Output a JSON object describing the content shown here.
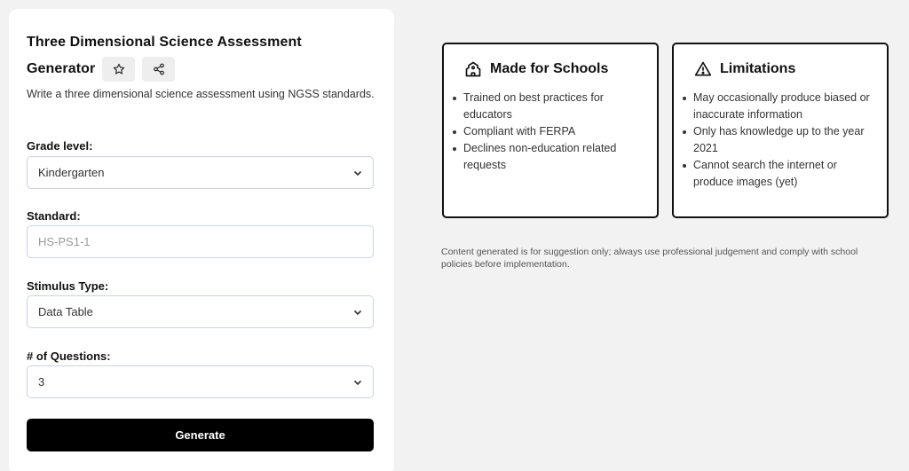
{
  "form": {
    "title_line1": "Three Dimensional Science Assessment",
    "title_line2": "Generator",
    "description": "Write a three dimensional science assessment using NGSS standards.",
    "grade_level": {
      "label": "Grade level:",
      "value": "Kindergarten"
    },
    "standard": {
      "label": "Standard:",
      "placeholder": "HS-PS1-1"
    },
    "stimulus_type": {
      "label": "Stimulus Type:",
      "value": "Data Table"
    },
    "num_questions": {
      "label": "# of Questions:",
      "value": "3"
    },
    "generate_label": "Generate"
  },
  "made_for_schools": {
    "title": "Made for Schools",
    "items": [
      "Trained on best practices for educators",
      "Compliant with FERPA",
      "Declines non-education related requests"
    ]
  },
  "limitations": {
    "title": "Limitations",
    "items": [
      "May occasionally produce biased or inaccurate information",
      "Only has knowledge up to the year 2021",
      "Cannot search the internet or produce images (yet)"
    ]
  },
  "disclaimer": "Content generated is for suggestion only; always use professional judgement and comply with school policies before implementation.",
  "colors": {
    "background": "#f2f2f3",
    "card": "#ffffff",
    "button": "#000000",
    "input_border": "#c9d3e8"
  },
  "icons": [
    "star-icon",
    "share-icon",
    "school-icon",
    "warning-icon",
    "chevron-down-icon"
  ]
}
